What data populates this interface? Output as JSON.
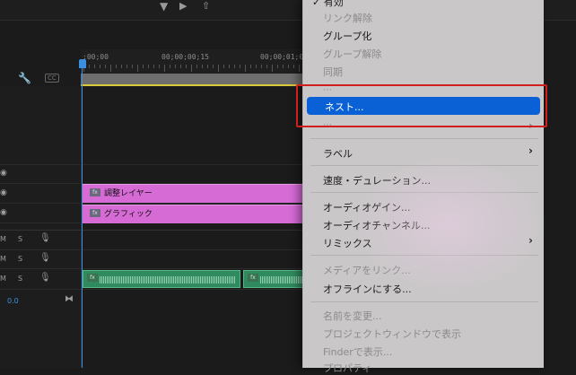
{
  "top_icons": [
    "filter-icon",
    "marker-icon",
    "export-icon"
  ],
  "timeline": {
    "timecodes": [
      ";00;00",
      "00;00;00;15",
      "00;00;01;0"
    ],
    "wrench": "wrench-icon",
    "cc_label": "CC",
    "audio_track_labels": [
      "M",
      "S",
      "M",
      "S",
      "M",
      "S"
    ],
    "master_value": "0.0",
    "clips": {
      "adjustment_layer": "調整レイヤー",
      "graphics": "グラフィック"
    },
    "fx_badge": "fx"
  },
  "menu": {
    "top_partial": "有効",
    "items_top": [
      {
        "label": "リンク解除",
        "disabled": true
      },
      {
        "label": "グループ化",
        "disabled": false
      },
      {
        "label": "グループ解除",
        "disabled": true
      },
      {
        "label": "同期",
        "disabled": true
      }
    ],
    "highlighted": "ネスト...",
    "label_item": "ラベル",
    "speed_item": "速度・デュレーション...",
    "audio_items": [
      "オーディオゲイン...",
      "オーディオチャンネル...",
      "リミックス"
    ],
    "media_items": [
      {
        "label": "メディアをリンク...",
        "disabled": true
      },
      {
        "label": "オフラインにする...",
        "disabled": false
      }
    ],
    "bottom_items": [
      {
        "label": "名前を変更...",
        "disabled": true
      },
      {
        "label": "プロジェクトウィンドウで表示",
        "disabled": true
      },
      {
        "label": "Finderで表示...",
        "disabled": true
      },
      {
        "label": "プロパティ",
        "disabled": true
      }
    ]
  },
  "colors": {
    "accent": "#0a61d6",
    "highlight_frame": "#d11f1f",
    "video_clip": "#d66bd6",
    "audio_clip": "#2f8a5f",
    "playhead": "#3b8fe0"
  }
}
